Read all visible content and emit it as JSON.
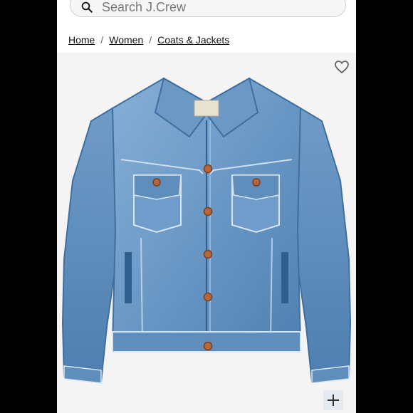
{
  "search": {
    "placeholder": "Search J.Crew"
  },
  "breadcrumb": {
    "items": [
      "Home",
      "Women",
      "Coats & Jackets"
    ],
    "separator": "/"
  },
  "product_image": {
    "subject": "denim-jacket-icon"
  },
  "colors": {
    "denim_light": "#7fa8cf",
    "denim_mid": "#5f8fbf",
    "denim_dark": "#3f6f9f",
    "button_copper": "#b5673b",
    "background": "#f4f4f4"
  },
  "icons": {
    "search": "search-icon",
    "wishlist": "heart-icon",
    "zoom": "plus-icon"
  }
}
